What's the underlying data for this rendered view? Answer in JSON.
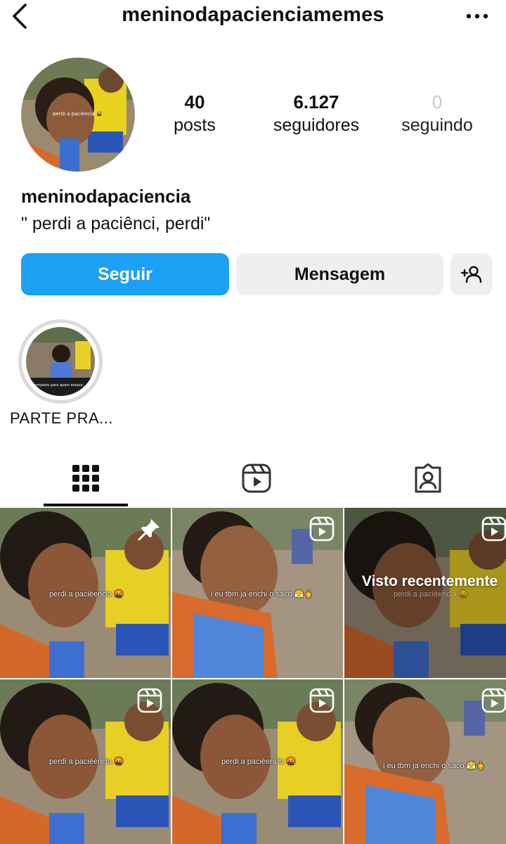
{
  "header": {
    "title": "meninodapacienciamemes",
    "back_icon": "chevron-left-icon",
    "more_icon": "more-horizontal-icon"
  },
  "profile": {
    "avatar_caption": "perdi a paciencia 🤬",
    "stats": {
      "posts": {
        "value": "40",
        "label": "posts"
      },
      "followers": {
        "value": "6.127",
        "label": "seguidores"
      },
      "following": {
        "value": "0",
        "label": "seguindo"
      }
    },
    "display_name": "meninodapaciencia",
    "bio": "\" perdi a paciênci, perdi\""
  },
  "actions": {
    "follow_label": "Seguir",
    "message_label": "Mensagem",
    "add_user_icon": "add-user-icon",
    "follow_color": "#1ba0f4"
  },
  "highlights": [
    {
      "label": "PARTE PRA...",
      "caption": "completo para quem estava..."
    }
  ],
  "tabs": [
    {
      "name": "posts-grid",
      "icon": "grid-icon",
      "active": true
    },
    {
      "name": "reels",
      "icon": "reels-icon",
      "active": false
    },
    {
      "name": "tagged",
      "icon": "tagged-icon",
      "active": false
    }
  ],
  "posts": [
    {
      "caption": "perdi a pacièencia 🤬",
      "badge": "pin-icon",
      "overlay": ""
    },
    {
      "caption": "i eu tbm ja enchi o saco 😤🖕",
      "badge": "reels-icon",
      "overlay": ""
    },
    {
      "caption": "perdi a pacièencia 🤬",
      "badge": "reels-icon",
      "overlay": "Visto recentemente"
    },
    {
      "caption": "perdi a pacièencia 🤬",
      "badge": "reels-icon",
      "overlay": ""
    },
    {
      "caption": "perdi a pacièencia 🤬",
      "badge": "reels-icon",
      "overlay": ""
    },
    {
      "caption": "i eu tbm ja enchi o saco 😤🖕",
      "badge": "reels-icon",
      "overlay": ""
    }
  ]
}
